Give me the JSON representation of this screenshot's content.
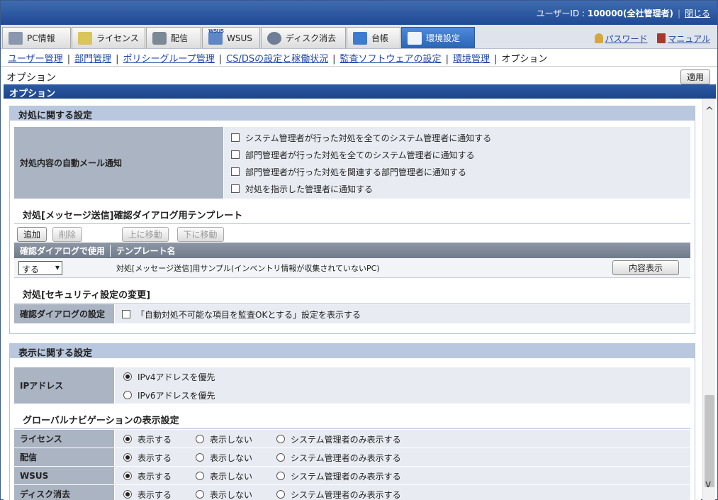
{
  "header": {
    "user_label": "ユーザーID : ",
    "user_value": "100000(全社管理者)",
    "logout": "閉じる"
  },
  "tabs": [
    {
      "label": "PC情報",
      "icon": "pc-icon"
    },
    {
      "label": "ライセンス",
      "icon": "license-icon"
    },
    {
      "label": "配信",
      "icon": "distribution-icon"
    },
    {
      "label": "WSUS",
      "icon": "wsus-icon"
    },
    {
      "label": "ディスク消去",
      "icon": "disk-erase-icon"
    },
    {
      "label": "台帳",
      "icon": "ledger-icon"
    },
    {
      "label": "環境設定",
      "icon": "settings-icon",
      "active": true
    }
  ],
  "wsus_tag": "WSUS",
  "toplinks": {
    "password": "パスワード",
    "manual": "マニュアル"
  },
  "subnav": [
    "ユーザー管理",
    "部門管理",
    "ポリシーグループ管理",
    "CS/DSの設定と稼働状況",
    "監査ソフトウェアの設定",
    "環境管理",
    "オプション"
  ],
  "page_title": "オプション",
  "apply_button": "適用",
  "section_title": "オプション",
  "action_settings": {
    "title": "対処に関する設定",
    "mail_label": "対処内容の自動メール通知",
    "mail_options": [
      "システム管理者が行った対処を全てのシステム管理者に通知する",
      "部門管理者が行った対処を全てのシステム管理者に通知する",
      "部門管理者が行った対処を関連する部門管理者に通知する",
      "対処を指示した管理者に通知する"
    ],
    "template_title": "対処[メッセージ送信]確認ダイアログ用テンプレート",
    "buttons": {
      "add": "追加",
      "delete": "削除",
      "up": "上に移動",
      "down": "下に移動"
    },
    "columns": [
      "確認ダイアログで使用",
      "テンプレート名"
    ],
    "rows": [
      {
        "use": "する",
        "name": "対処[メッセージ送信]用サンプル(インベントリ情報が収集されていないPC)",
        "action": "内容表示"
      }
    ],
    "security_title": "対処[セキュリティ設定の変更]",
    "confirm_label": "確認ダイアログの設定",
    "confirm_option": "「自動対処不可能な項目を監査OKとする」設定を表示する"
  },
  "display_settings": {
    "title": "表示に関する設定",
    "ip_label": "IPアドレス",
    "ip_options": [
      "IPv4アドレスを優先",
      "IPv6アドレスを優先"
    ],
    "nav_title": "グローバルナビゲーションの表示設定",
    "nav_rows": [
      {
        "label": "ライセンス"
      },
      {
        "label": "配信"
      },
      {
        "label": "WSUS"
      },
      {
        "label": "ディスク消去"
      }
    ],
    "nav_options": [
      "表示する",
      "表示しない",
      "システム管理者のみ表示する"
    ]
  }
}
